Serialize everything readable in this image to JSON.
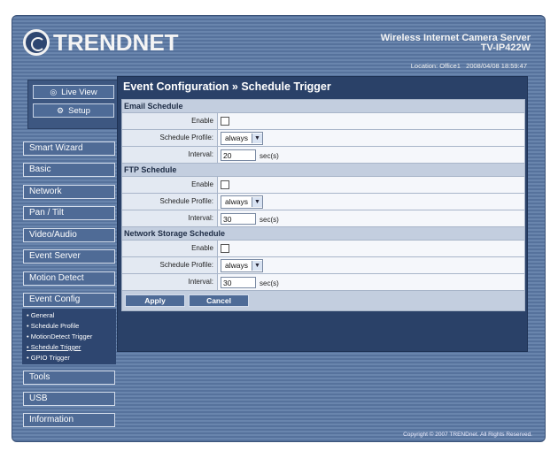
{
  "brand": {
    "logo_text": "TRENDNET"
  },
  "product": {
    "name": "Wireless Internet Camera Server",
    "model": "TV-IP422W"
  },
  "status": {
    "location_label": "Location:",
    "location_value": "Office1",
    "datetime": "2008/04/08 18:59:47"
  },
  "top_buttons": {
    "live_view": "Live View",
    "setup": "Setup"
  },
  "menu": {
    "smart_wizard": "Smart Wizard",
    "basic": "Basic",
    "network": "Network",
    "pan_tilt": "Pan / Tilt",
    "video_audio": "Video/Audio",
    "event_server": "Event Server",
    "motion_detect": "Motion Detect",
    "event_config": "Event Config",
    "tools": "Tools",
    "usb": "USB",
    "information": "Information"
  },
  "submenu": {
    "general": "• General",
    "schedule_profile": "• Schedule Profile",
    "motiondetect_trigger": "• MotionDetect Trigger",
    "schedule_trigger": "• Schedule Trigger",
    "gpio_trigger": "• GPIO Trigger"
  },
  "page": {
    "title": "Event Configuration » Schedule Trigger"
  },
  "email": {
    "header": "Email Schedule",
    "enable_label": "Enable",
    "profile_label": "Schedule Profile:",
    "profile_value": "always",
    "interval_label": "Interval:",
    "interval_value": "20",
    "unit": "sec(s)"
  },
  "ftp": {
    "header": "FTP Schedule",
    "enable_label": "Enable",
    "profile_label": "Schedule Profile:",
    "profile_value": "always",
    "interval_label": "Interval:",
    "interval_value": "30",
    "unit": "sec(s)"
  },
  "nas": {
    "header": "Network Storage Schedule",
    "enable_label": "Enable",
    "profile_label": "Schedule Profile:",
    "profile_value": "always",
    "interval_label": "Interval:",
    "interval_value": "30",
    "unit": "sec(s)"
  },
  "actions": {
    "apply": "Apply",
    "cancel": "Cancel"
  },
  "footer": {
    "copyright": "Copyright © 2007 TRENDnet. All Rights Reserved."
  }
}
